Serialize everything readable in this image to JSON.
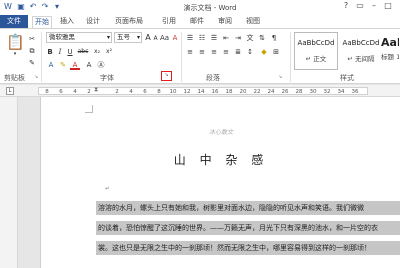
{
  "titlebar": {
    "title": "演示文档 - Word"
  },
  "tabs": {
    "file": "文件",
    "items": [
      "开始",
      "插入",
      "设计",
      "页面布局",
      "引用",
      "邮件",
      "审阅",
      "视图"
    ]
  },
  "ribbon": {
    "font_name": "微软雅黑",
    "font_size": "五号",
    "font_grow": "A",
    "font_shrink": "A",
    "change_case": "Aa",
    "clear_format": "A",
    "bold": "B",
    "italic": "I",
    "underline": "U",
    "strike": "abc",
    "subscript": "x₂",
    "superscript": "x²",
    "font_color": "A",
    "groups": {
      "clipboard": "剪贴板",
      "font": "字体",
      "paragraph": "段落",
      "styles": "样式"
    },
    "styles": [
      {
        "sample": "AaBbCcDd",
        "name": "↵ 正文"
      },
      {
        "sample": "AaBbCcDd",
        "name": "↵ 无间隔"
      },
      {
        "sample": "AaBb",
        "name": "标题 1"
      }
    ]
  },
  "ruler": {
    "ticks": [
      "8",
      "6",
      "4",
      "2",
      "",
      "2",
      "4",
      "6",
      "8",
      "10",
      "12",
      "14",
      "16",
      "18",
      "20",
      "22",
      "24",
      "26",
      "28",
      "30",
      "32",
      "34",
      "36"
    ]
  },
  "document": {
    "header": "冰心散文",
    "heading": "山 中 杂 感",
    "lines": [
      "溶溶的水月，螺头上只有她和我，树影里对面水边，隐隐的听见水声和笑语。我们微微",
      "的谈着，恐怕惊醒了这沉睡的世界。——万籁无声，月光下只有深黑的池水，和一片空的衣",
      "裳。这也只是无限之生中的一刹那顷！然而无限之生中，哪里容易得到这样的一刹那顷！"
    ]
  },
  "colors": {
    "accent": "#2b579a",
    "highlight": "#c6c6c6",
    "launcher_highlight": "#e02020"
  }
}
